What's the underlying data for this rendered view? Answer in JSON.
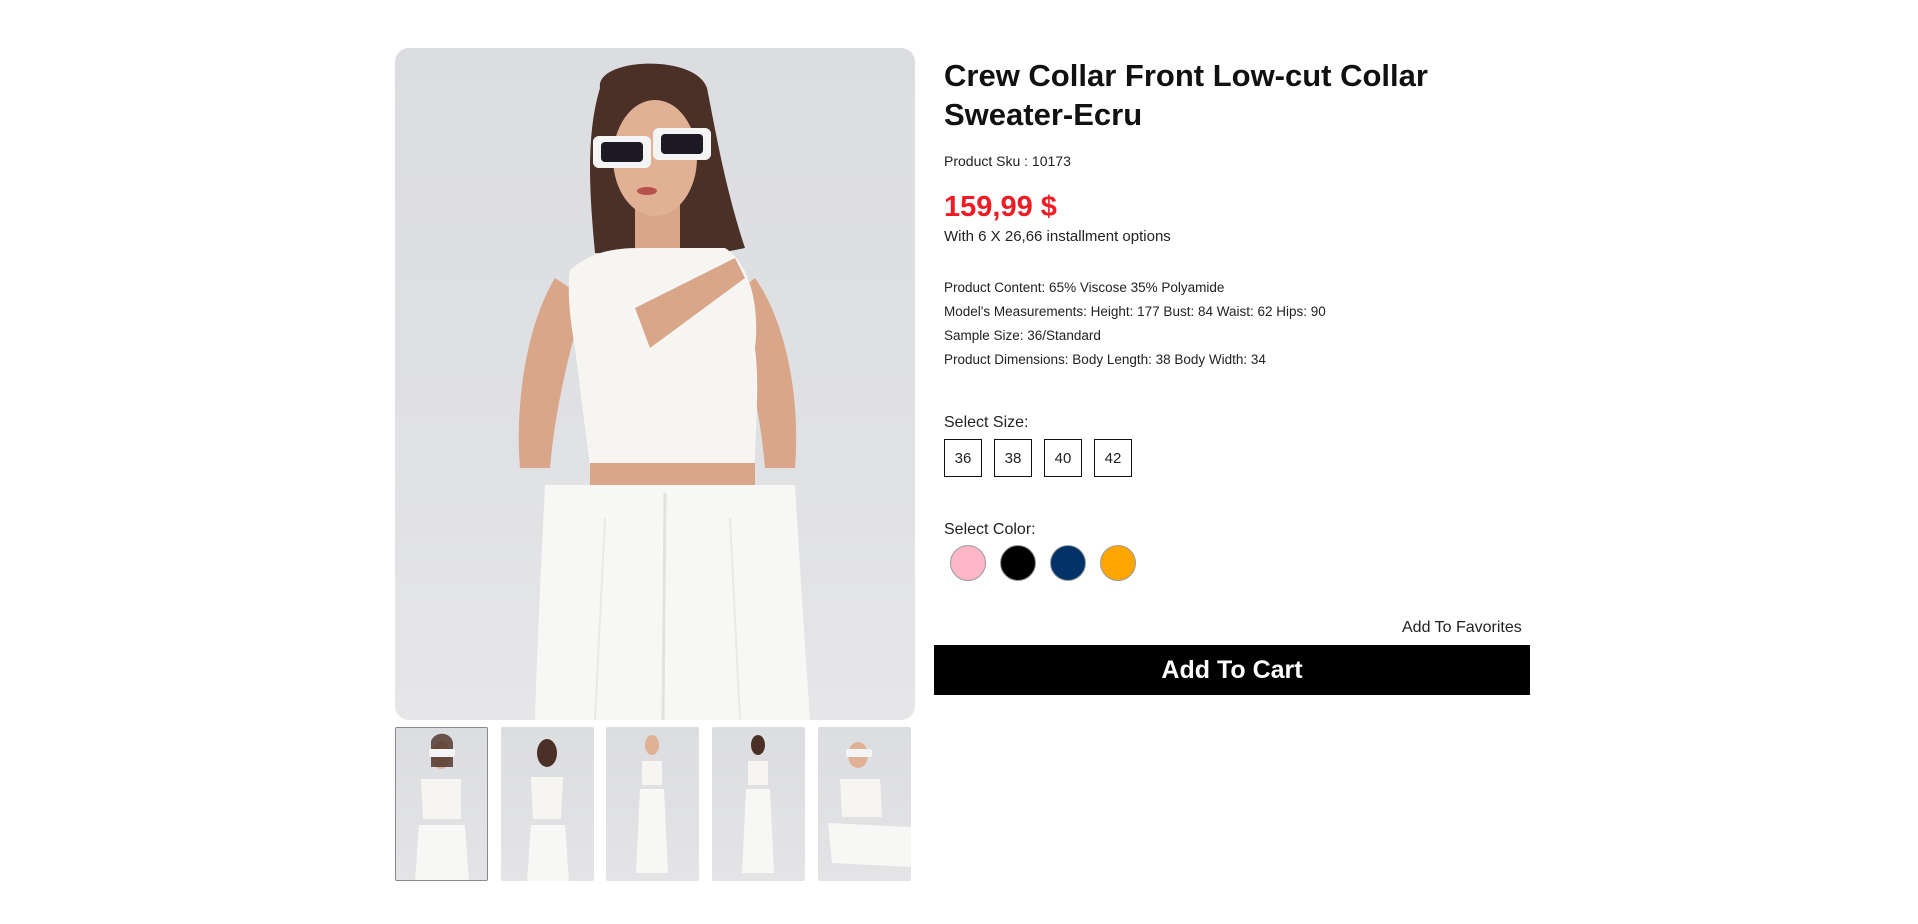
{
  "product": {
    "title": "Crew Collar Front Low-cut Collar Sweater-Ecru",
    "sku": "Product Sku : 10173",
    "price": "159,99 $",
    "installment": "With 6 X 26,66 installment options",
    "specs": [
      "Product Content: 65% Viscose 35% Polyamide",
      "Model's Measurements: Height: 177 Bust: 84 Waist: 62 Hips: 90",
      "Sample Size: 36/Standard",
      "Product Dimensions: Body Length: 38 Body Width: 34"
    ]
  },
  "size_selector": {
    "label": "Select Size:",
    "options": [
      "36",
      "38",
      "40",
      "42"
    ]
  },
  "color_selector": {
    "label": "Select Color:",
    "swatches": [
      {
        "name": "pink",
        "hex": "#ffb6c6"
      },
      {
        "name": "black",
        "hex": "#000000"
      },
      {
        "name": "navy",
        "hex": "#033268"
      },
      {
        "name": "orange",
        "hex": "#ffa500"
      }
    ]
  },
  "actions": {
    "favorites_label": "Add To Favorites",
    "add_to_cart_label": "Add To Cart"
  },
  "colors": {
    "price": "#ef1c25",
    "cart_button_bg": "#000000",
    "cart_button_text": "#ffffff"
  }
}
